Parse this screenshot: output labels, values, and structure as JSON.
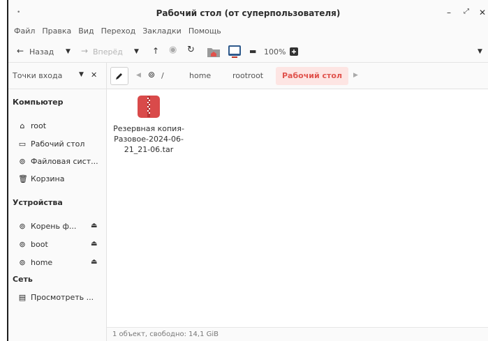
{
  "window": {
    "title": "Рабочий стол (от суперпользователя)",
    "minimize": "–",
    "maximize": "⤢",
    "close": "✕"
  },
  "menu": [
    "Файл",
    "Правка",
    "Вид",
    "Переход",
    "Закладки",
    "Помощь"
  ],
  "toolbar": {
    "back": "Назад",
    "forward": "Вперёд",
    "zoom": "100%"
  },
  "sidebar": {
    "header": "Точки входа",
    "sections": {
      "computer": "Компьютер",
      "devices": "Устройства",
      "network": "Сеть"
    },
    "computer_items": [
      "root",
      "Рабочий стол",
      "Файловая сист..."
    ],
    "trash": "Корзина",
    "device_items": [
      "Корень ф...",
      "boot",
      "home"
    ],
    "network_items": [
      "Просмотреть ..."
    ]
  },
  "pathbar": {
    "root_sep": "/",
    "segments": [
      "home",
      "rootroot",
      "Рабочий стол"
    ]
  },
  "files": [
    {
      "name": "Резервная копия-Разовое-2024-06-21_21-06.tar",
      "icon": "archive-icon",
      "color": "#d94a4a"
    }
  ],
  "status": "1 объект, свободно: 14,1 GiB",
  "colors": {
    "accent": "#e0524c",
    "accent_bg": "#fde5e3"
  }
}
